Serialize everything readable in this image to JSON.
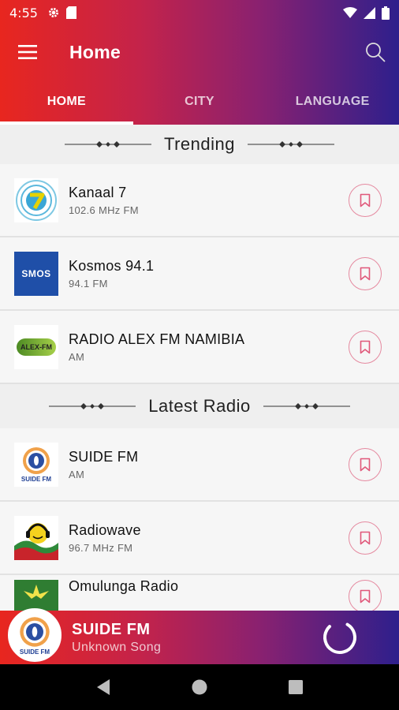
{
  "status_bar": {
    "time": "4:55"
  },
  "app_bar": {
    "title": "Home"
  },
  "tabs": [
    {
      "label": "HOME"
    },
    {
      "label": "CITY"
    },
    {
      "label": "LANGUAGE"
    }
  ],
  "sections": {
    "trending": {
      "title": "Trending",
      "stations": [
        {
          "name": "Kanaal 7",
          "freq": "102.6 MHz FM",
          "logo": "kanaal7-logo"
        },
        {
          "name": "Kosmos 94.1",
          "freq": "94.1 FM",
          "logo": "kosmos-logo",
          "logo_text": "SMOS"
        },
        {
          "name": "RADIO ALEX FM NAMIBIA",
          "freq": "AM",
          "logo": "alexfm-logo",
          "logo_text": "ALEX-FM"
        }
      ]
    },
    "latest": {
      "title": "Latest Radio",
      "stations": [
        {
          "name": "SUIDE FM",
          "freq": "AM",
          "logo": "suidefm-logo",
          "logo_text": "SUIDE FM"
        },
        {
          "name": "Radiowave",
          "freq": "96.7 MHz FM",
          "logo": "radiowave-logo"
        },
        {
          "name": "Omulunga Radio",
          "freq": "",
          "logo": "omulunga-logo"
        }
      ]
    }
  },
  "player": {
    "station": "SUIDE FM",
    "song": "Unknown Song",
    "logo_text": "SUIDE FM"
  },
  "colors": {
    "gradient_start": "#e8261f",
    "gradient_end": "#2e1f8c",
    "fav_border": "#e58aa0"
  },
  "icons": [
    "menu-icon",
    "search-icon",
    "bookmark-icon",
    "loading-spinner-icon",
    "back-icon",
    "home-icon",
    "recents-icon"
  ]
}
